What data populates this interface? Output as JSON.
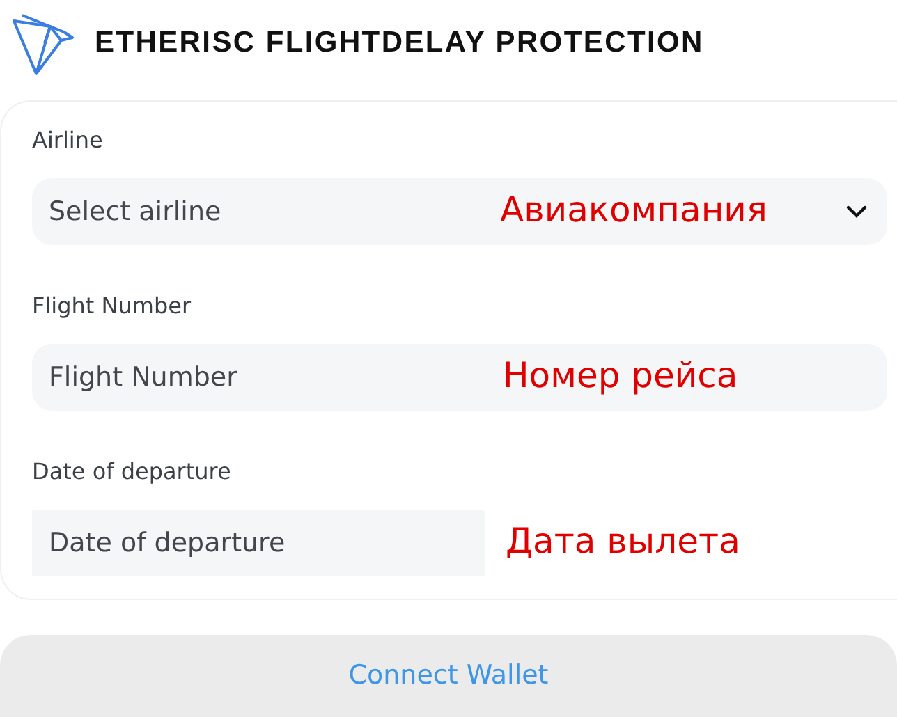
{
  "header": {
    "title": "ETHERISC FLIGHTDELAY PROTECTION"
  },
  "fields": [
    {
      "kind": "select",
      "label": "Airline",
      "placeholder": "Select airline",
      "annotation": "Авиакомпания"
    },
    {
      "kind": "text",
      "label": "Flight Number",
      "placeholder": "Flight Number",
      "annotation": "Номер рейса"
    },
    {
      "kind": "date",
      "label": "Date of departure",
      "placeholder": "Date of departure",
      "annotation": "Дата вылета"
    }
  ],
  "button": {
    "label": "Connect Wallet"
  }
}
